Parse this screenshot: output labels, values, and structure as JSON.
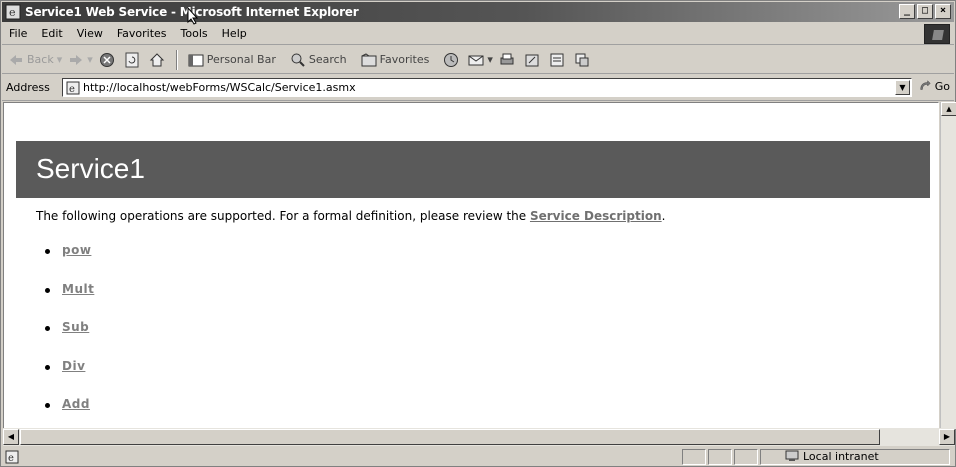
{
  "window": {
    "title": "Service1 Web Service - Microsoft Internet Explorer",
    "controls": {
      "minimize": "_",
      "maximize": "□",
      "close": "×"
    }
  },
  "menu": {
    "items": [
      "File",
      "Edit",
      "View",
      "Favorites",
      "Tools",
      "Help"
    ]
  },
  "toolbar": {
    "back": "Back",
    "personal_bar": "Personal Bar",
    "search": "Search",
    "favorites": "Favorites"
  },
  "address": {
    "label": "Address",
    "url": "http://localhost/webForms/WSCalc/Service1.asmx",
    "go": "Go"
  },
  "page": {
    "heading": "Service1",
    "intro": "The following operations are supported. For a formal definition, please review the ",
    "service_description_link": "Service Description",
    "intro_end": ".",
    "operations": [
      "pow",
      "Mult",
      "Sub",
      "Div",
      "Add"
    ]
  },
  "status": {
    "zone": "Local intranet"
  },
  "colors": {
    "titlebar": "#3a3a3a",
    "heading_band": "#5a5a5a",
    "link": "#808080"
  }
}
